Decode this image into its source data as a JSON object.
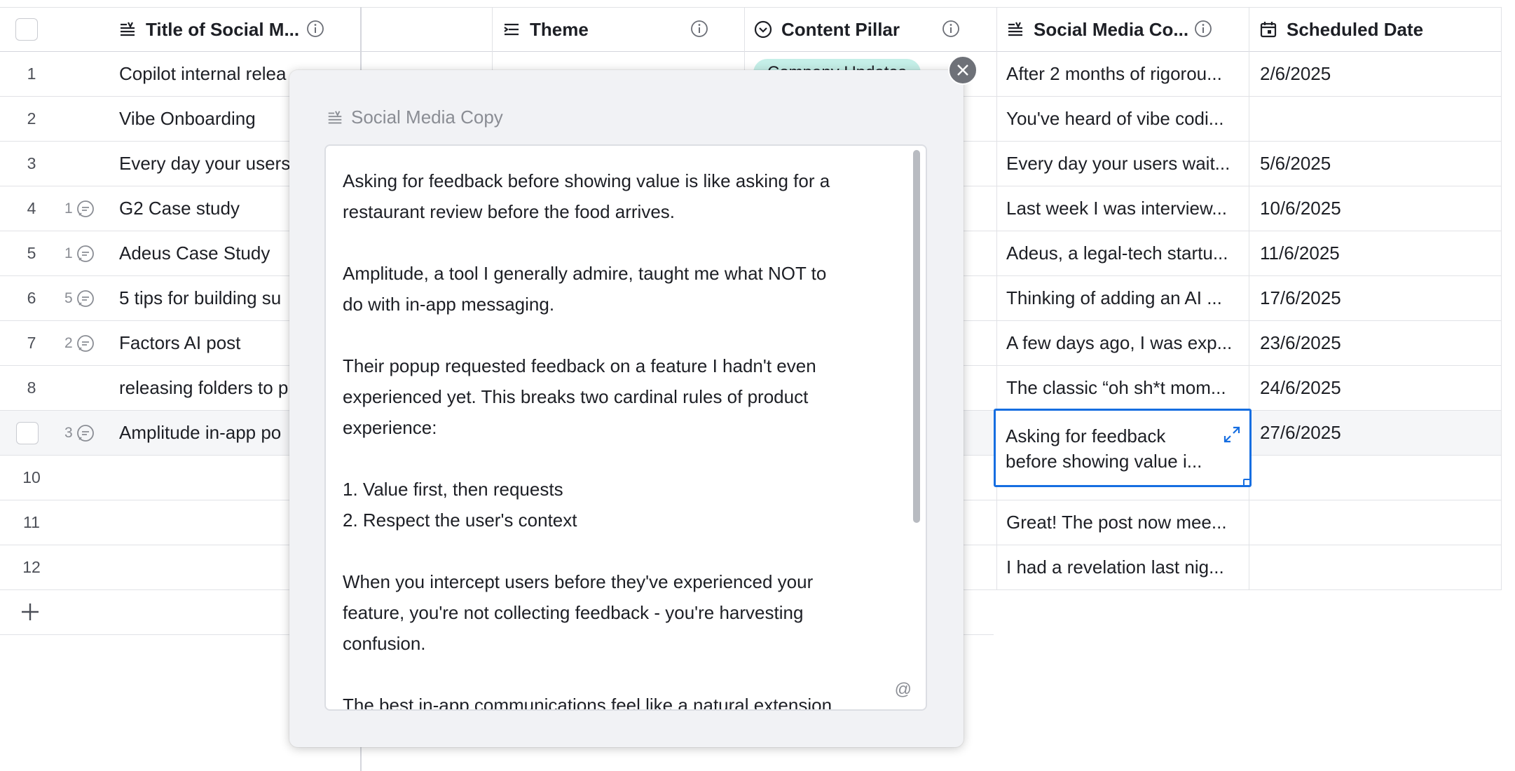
{
  "columns": {
    "title": "Title of Social M...",
    "theme": "Theme",
    "pillar": "Content Pillar",
    "copy": "Social Media Co...",
    "date": "Scheduled Date"
  },
  "rows": [
    {
      "num": "1",
      "comments": "",
      "title": "Copilot internal relea",
      "copy": "After 2 months of rigorou...",
      "date": "2/6/2025"
    },
    {
      "num": "2",
      "comments": "",
      "title": "Vibe Onboarding",
      "copy": "You've heard of vibe codi...",
      "date": ""
    },
    {
      "num": "3",
      "comments": "",
      "title": "Every day your users",
      "copy": "Every day your users wait...",
      "date": "5/6/2025"
    },
    {
      "num": "4",
      "comments": "1",
      "title": "G2 Case study",
      "copy": "Last week I was interview...",
      "date": "10/6/2025"
    },
    {
      "num": "5",
      "comments": "1",
      "title": "Adeus Case Study",
      "copy": "Adeus, a legal-tech startu...",
      "date": "11/6/2025"
    },
    {
      "num": "6",
      "comments": "5",
      "title": "5 tips for building su",
      "copy": "Thinking of adding an AI ...",
      "date": "17/6/2025"
    },
    {
      "num": "7",
      "comments": "2",
      "title": "Factors AI post",
      "copy": "A few days ago, I was exp...",
      "date": "23/6/2025"
    },
    {
      "num": "8",
      "comments": "",
      "title": "releasing folders to p",
      "copy": "The classic “oh sh*t mom...",
      "date": "24/6/2025"
    },
    {
      "num": "",
      "comments": "3",
      "title": "Amplitude in-app po",
      "copy": "",
      "date": "27/6/2025"
    },
    {
      "num": "10",
      "comments": "",
      "title": "",
      "copy": "",
      "date": ""
    },
    {
      "num": "11",
      "comments": "",
      "title": "",
      "copy": "Great! The post now mee...",
      "date": ""
    },
    {
      "num": "12",
      "comments": "",
      "title": "",
      "copy": "I had a revelation last nig...",
      "date": ""
    }
  ],
  "pill_label": "Company Updates",
  "active_cell_text": "Asking for feedback before showing value i...",
  "modal": {
    "label": "Social Media Copy",
    "text": "Asking for feedback before showing value is like asking for a\nrestaurant review before the food arrives.\n\nAmplitude, a tool I generally admire, taught me what NOT to\ndo with in-app messaging.\n\nTheir popup requested feedback on a feature I hadn't even\nexperienced yet. This breaks two cardinal rules of product\nexperience:\n\n1. Value first, then requests\n2. Respect the user's context\n\nWhen you intercept users before they've experienced your\nfeature, you're not collecting feedback - you're harvesting\nconfusion.\n\nThe best in-app communications feel like a natural extension",
    "mention": "@"
  },
  "icons": {
    "long_text": "long-text-icon",
    "info": "info-icon",
    "single_select": "single-select-icon",
    "date": "calendar-icon",
    "comment": "comment-icon",
    "close": "close-icon",
    "expand": "expand-icon",
    "add": "plus-icon"
  },
  "colors": {
    "accent": "#166ee1",
    "pill": "#c5efe8",
    "modal_bg": "#f1f2f5"
  }
}
